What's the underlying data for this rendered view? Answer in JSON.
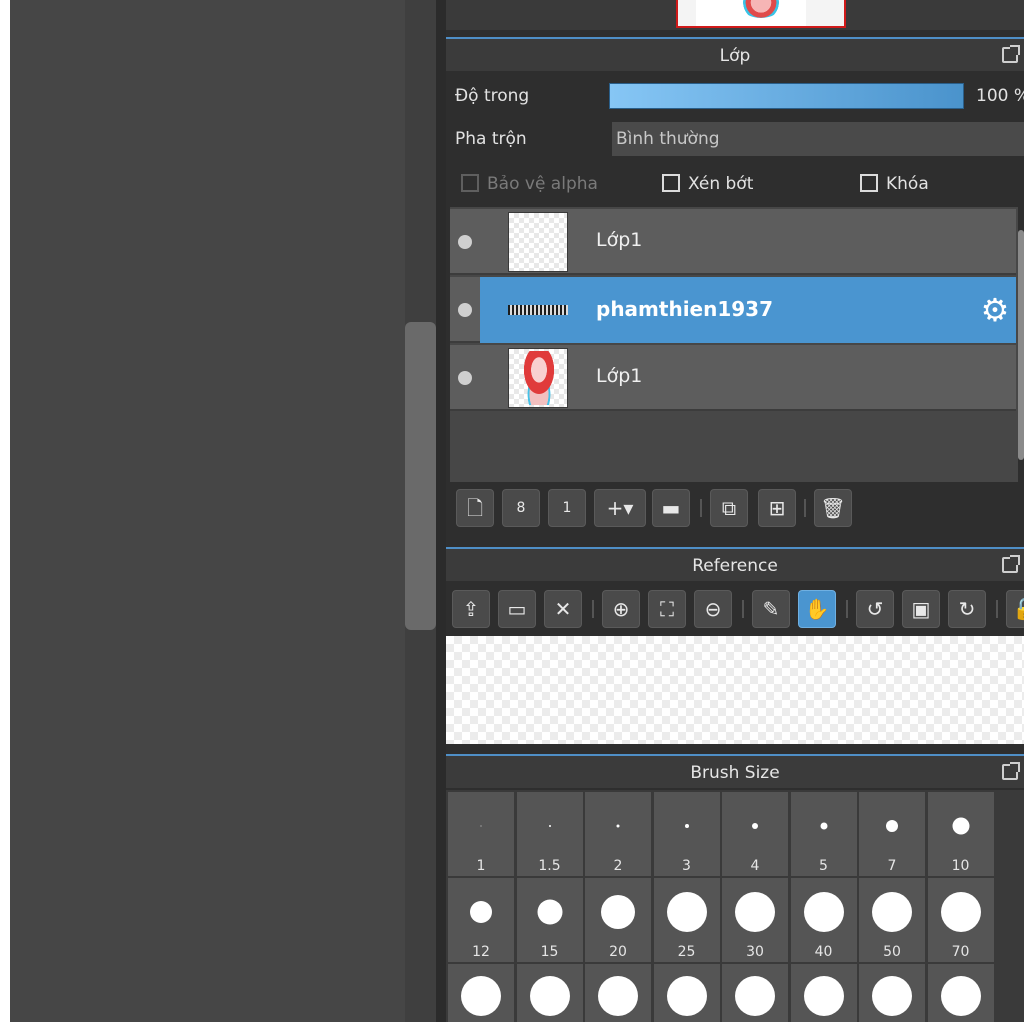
{
  "layer_panel": {
    "title": "Lớp",
    "opacity_label": "Độ trong",
    "opacity_value": "100 %",
    "blend_label": "Pha trộn",
    "blend_value": "Bình thường",
    "protect_alpha": "Bảo vệ alpha",
    "clipping": "Xén bớt",
    "lock": "Khóa",
    "layers": [
      {
        "name": "Lớp1",
        "selected": false
      },
      {
        "name": "phamthien1937",
        "selected": true
      },
      {
        "name": "Lớp1",
        "selected": false
      }
    ],
    "toolbar_icons": [
      "new-layer-icon",
      "new-8bit-layer-icon",
      "new-1bit-layer-icon",
      "add-layer-menu-icon",
      "folder-icon",
      "duplicate-icon",
      "merge-icon",
      "trash-icon"
    ]
  },
  "reference_panel": {
    "title": "Reference",
    "toolbar_icons": [
      "upload-icon",
      "open-folder-icon",
      "close-icon",
      "zoom-in-icon",
      "fit-icon",
      "zoom-out-icon",
      "eyedropper-icon",
      "hand-icon",
      "rotate-left-icon",
      "actual-size-icon",
      "rotate-right-icon",
      "lock-icon"
    ]
  },
  "brush_panel": {
    "title": "Brush Size",
    "sizes": [
      "1",
      "1.5",
      "2",
      "3",
      "4",
      "5",
      "7",
      "10",
      "12",
      "15",
      "20",
      "25",
      "30",
      "40",
      "50",
      "70"
    ]
  },
  "colors": {
    "accent": "#4a95d0",
    "panel_bg": "#2e2e2e",
    "canvas_bg": "#464646"
  }
}
